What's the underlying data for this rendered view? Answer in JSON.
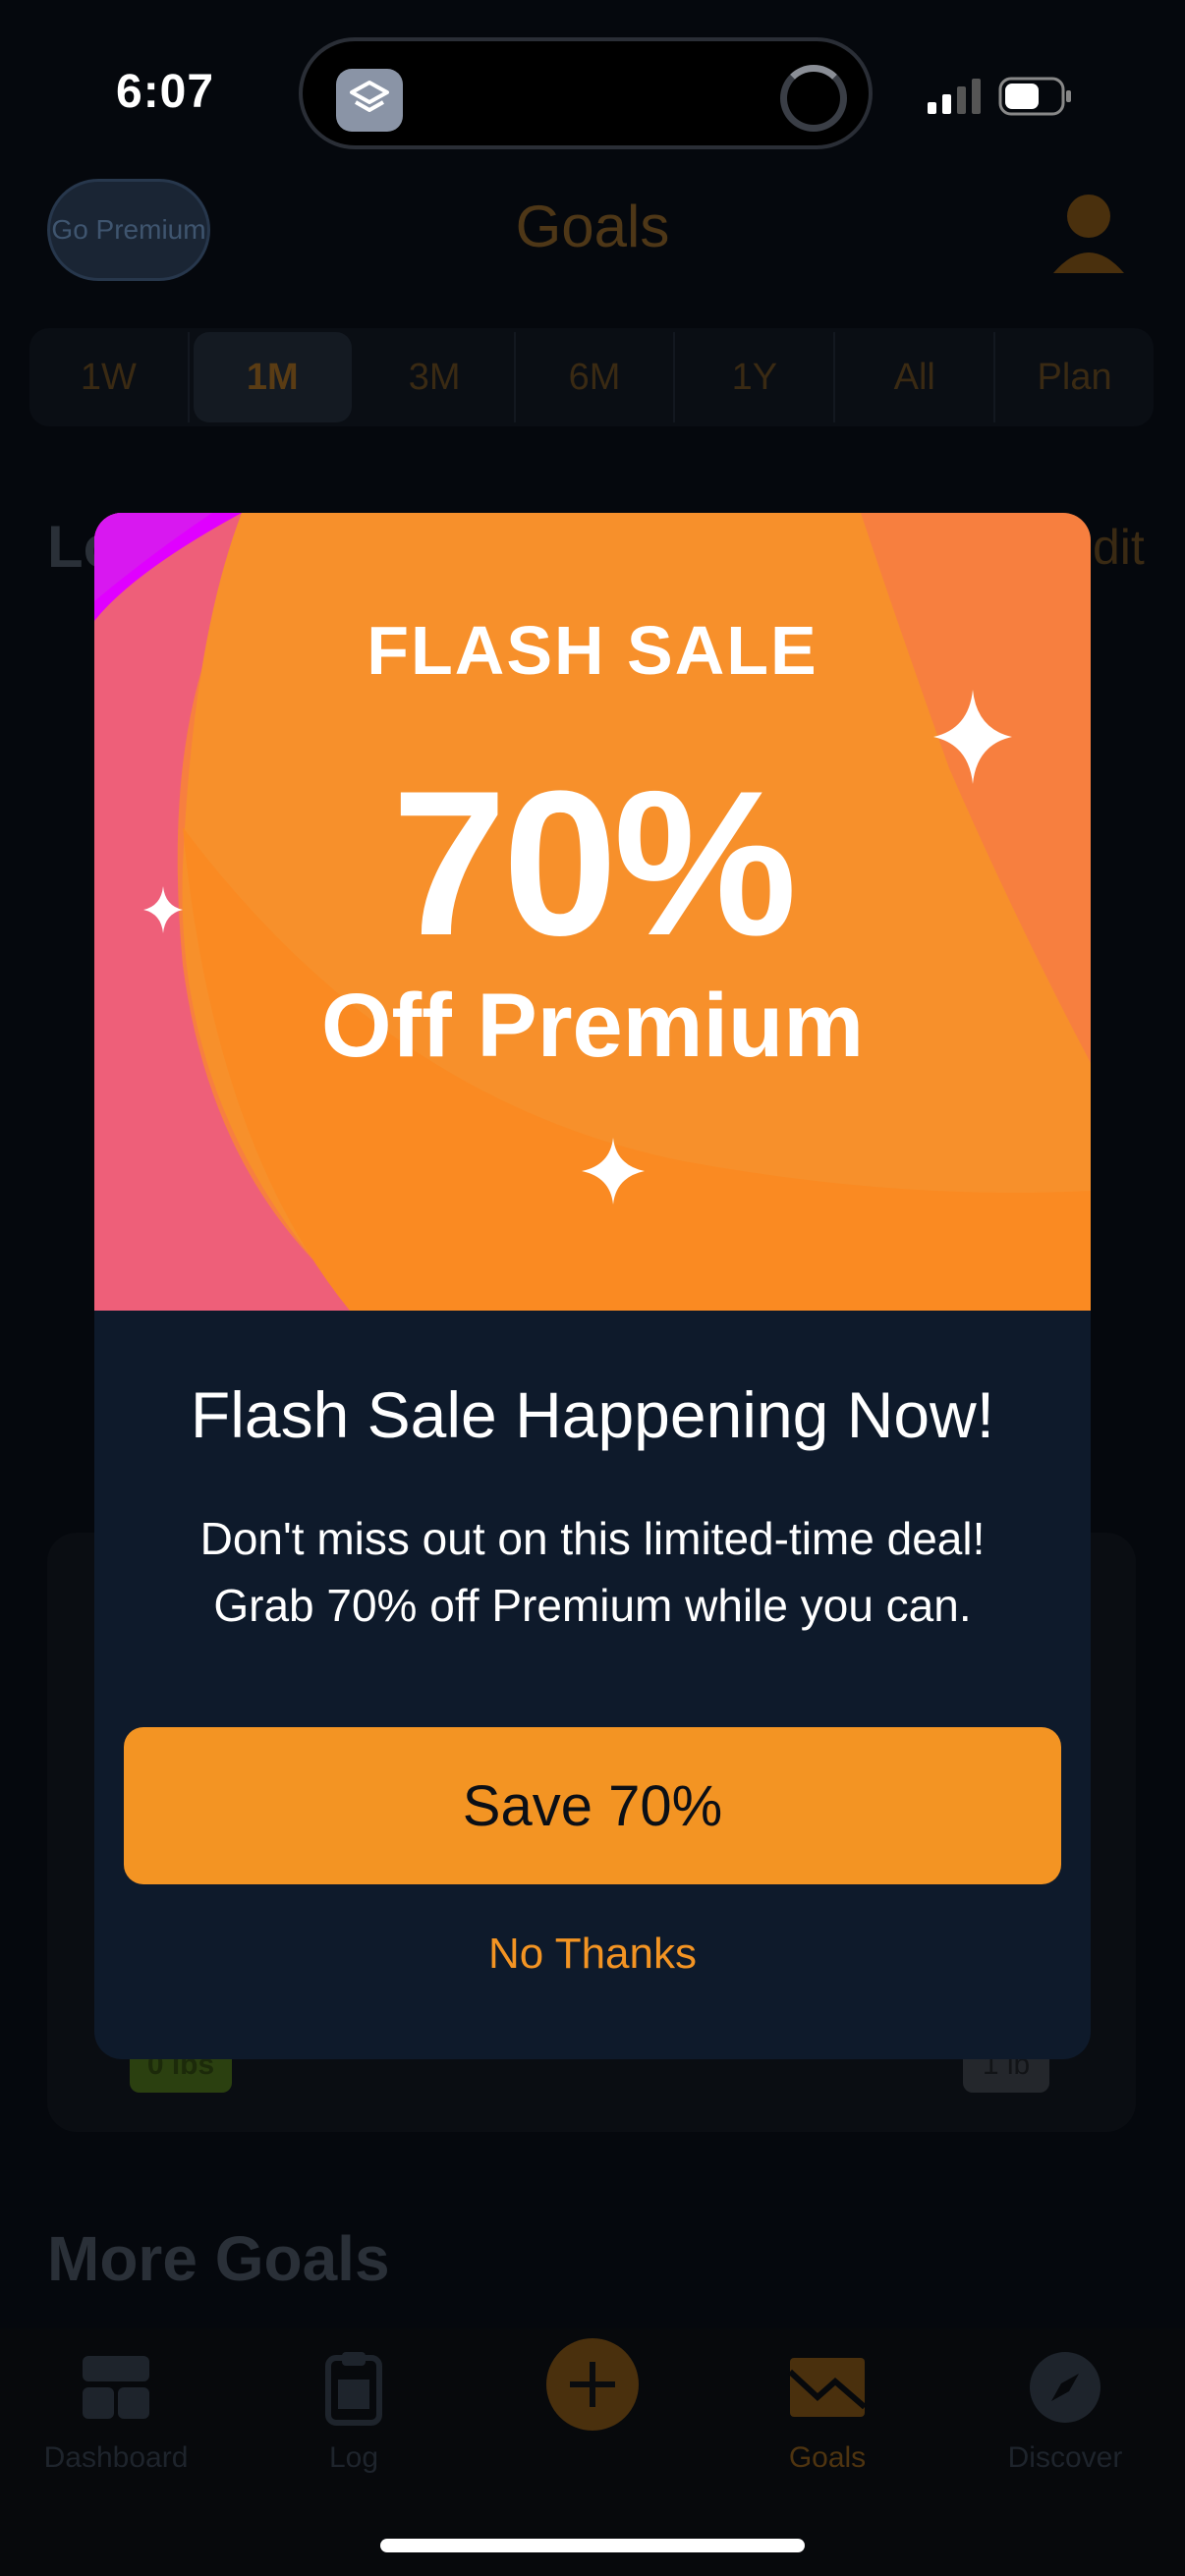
{
  "status_bar": {
    "time": "6:07"
  },
  "header": {
    "go_premium": "Go Premium",
    "title": "Goals"
  },
  "range_tabs": [
    "1W",
    "1M",
    "3M",
    "6M",
    "1Y",
    "All",
    "Plan"
  ],
  "section": {
    "partial_title": "Lo",
    "edit_partial": "dit"
  },
  "goal_card": {
    "left_badge": "0 lbs",
    "right_badge": "1 lb"
  },
  "more_goals": "More Goals",
  "tabbar": {
    "dashboard": "Dashboard",
    "log": "Log",
    "goals": "Goals",
    "discover": "Discover"
  },
  "modal": {
    "banner_top": "FLASH SALE",
    "banner_percent": "70%",
    "banner_bottom": "Off Premium",
    "title": "Flash Sale Happening Now!",
    "body_line1": "Don't miss out on this limited-time deal!",
    "body_line2": "Grab 70% off Premium while you can.",
    "cta": "Save 70%",
    "dismiss": "No Thanks"
  },
  "colors": {
    "accent": "#f39423",
    "modal_bg": "#0e1a2b",
    "banner_orange": "#f7902b",
    "banner_pink": "#ee5f79",
    "banner_magenta": "#e000ff"
  }
}
